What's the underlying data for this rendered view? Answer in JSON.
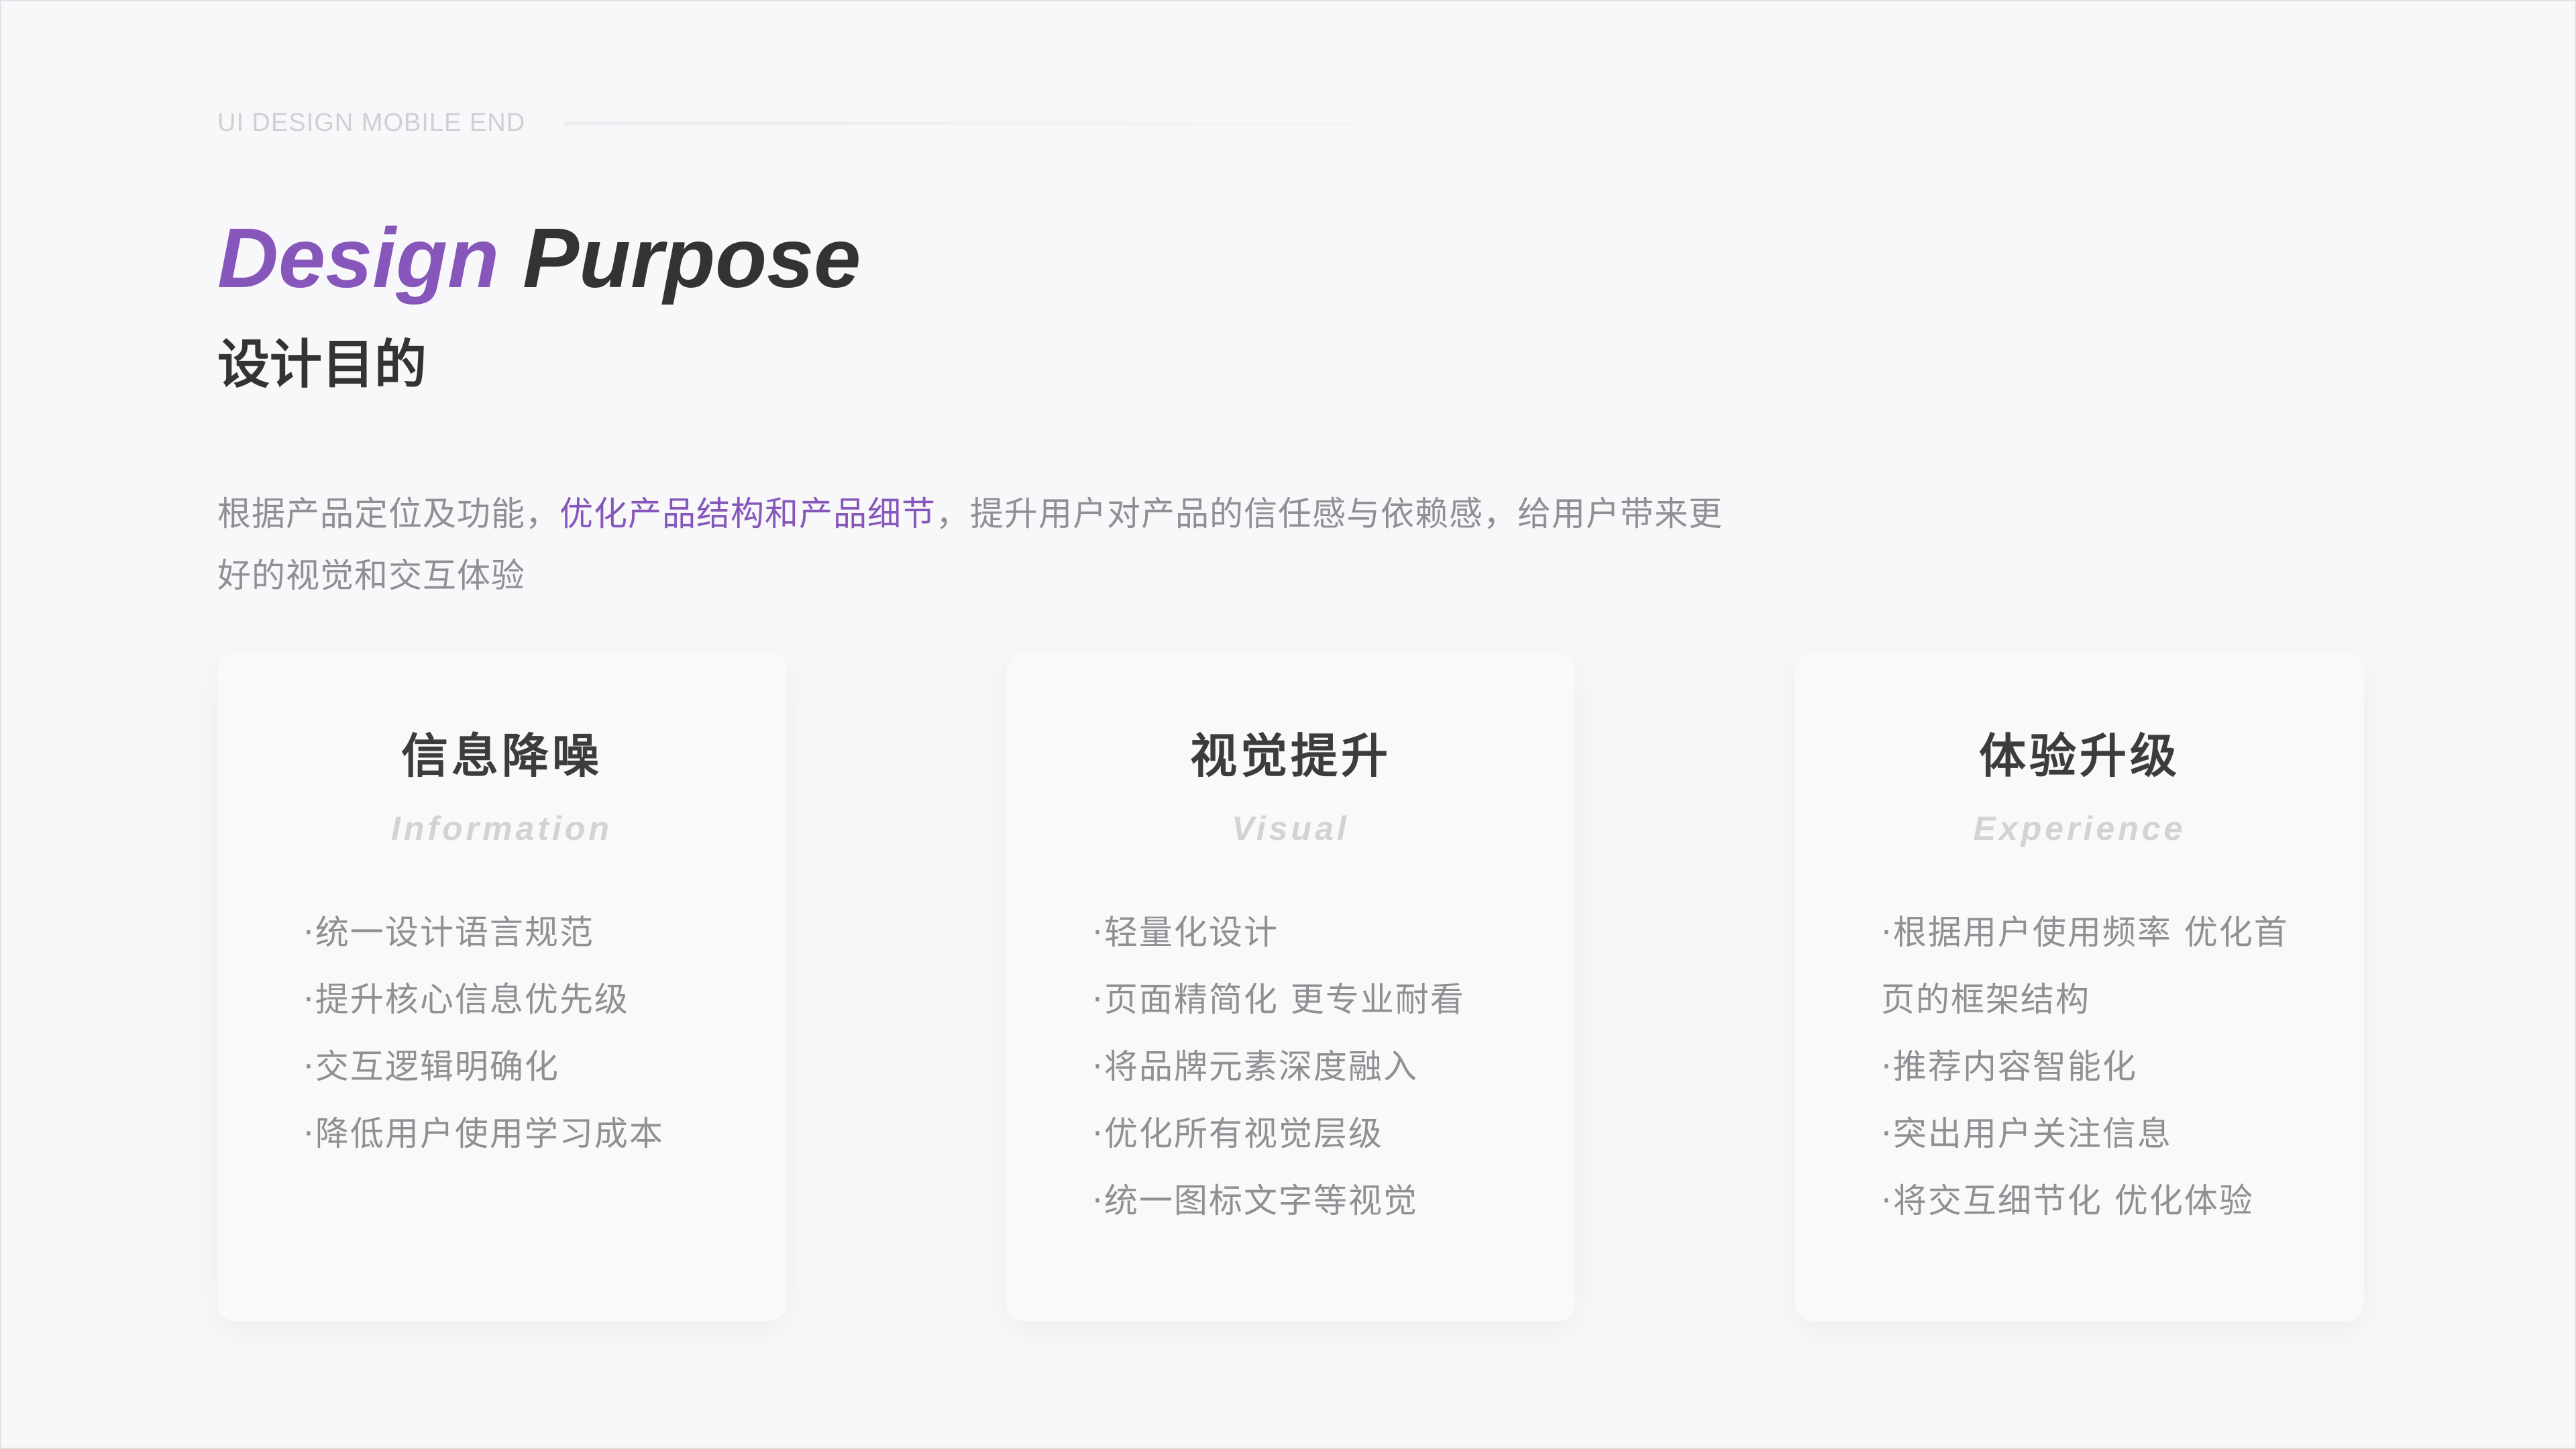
{
  "header": {
    "eyebrow": "UI DESIGN MOBILE END",
    "title_accent": "Design",
    "title_rest": "Purpose",
    "subtitle": "设计目的"
  },
  "intro": {
    "before": "根据产品定位及功能，",
    "highlight": "优化产品结构和产品细节",
    "after": "，提升用户对产品的信任感与依赖感，给用户带来更好的视觉和交互体验"
  },
  "cards": [
    {
      "title": "信息降噪",
      "subtitle": "Information",
      "items": [
        "·统一设计语言规范",
        "·提升核心信息优先级",
        "·交互逻辑明确化",
        "·降低用户使用学习成本"
      ]
    },
    {
      "title": "视觉提升",
      "subtitle": "Visual",
      "items": [
        "·轻量化设计",
        "·页面精简化 更专业耐看",
        "·将品牌元素深度融入",
        "·优化所有视觉层级",
        "·统一图标文字等视觉"
      ]
    },
    {
      "title": "体验升级",
      "subtitle": "Experience",
      "items": [
        "·根据用户使用频率 优化首页的框架结构",
        "·推荐内容智能化",
        "·突出用户关注信息",
        "·将交互细节化 优化体验"
      ]
    }
  ],
  "colors": {
    "accent": "#8656bb",
    "heading": "#333333",
    "body_text": "#8f8f94",
    "muted": "#d3d3d6",
    "background": "#f8f8fa"
  }
}
